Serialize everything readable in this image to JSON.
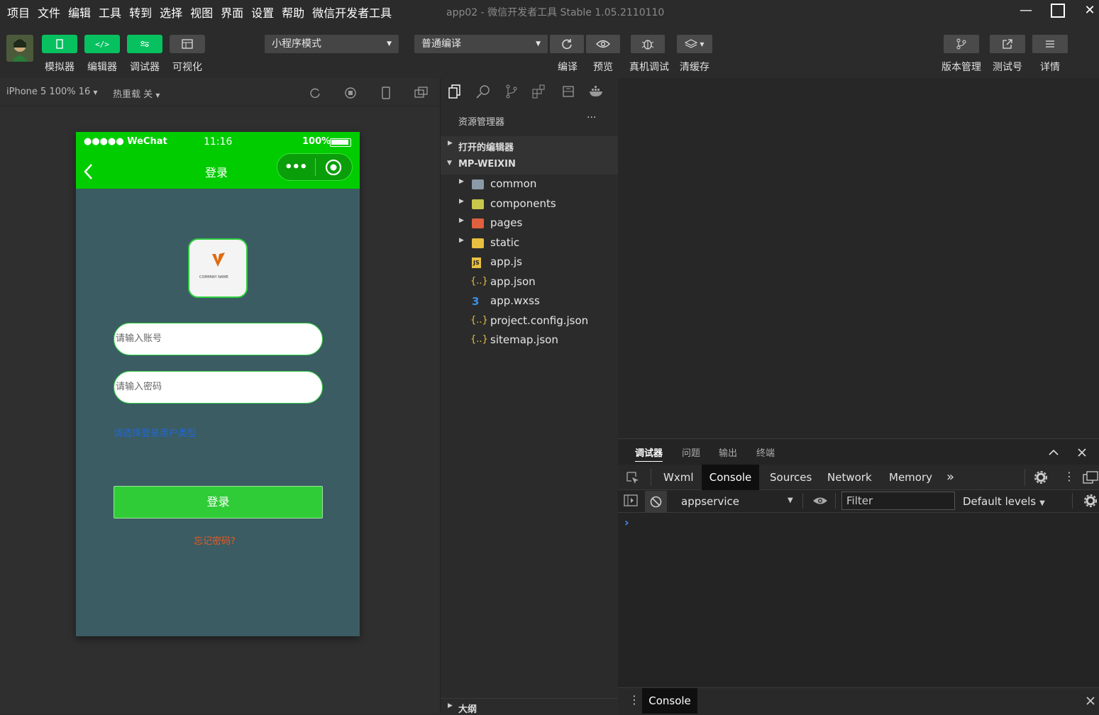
{
  "menubar": {
    "items": [
      "项目",
      "文件",
      "编辑",
      "工具",
      "转到",
      "选择",
      "视图",
      "界面",
      "设置",
      "帮助",
      "微信开发者工具"
    ],
    "window_title": "app02 - 微信开发者工具 Stable 1.05.2110110"
  },
  "toolbar": {
    "left_buttons": [
      {
        "label": "模拟器",
        "icon": "phone-icon"
      },
      {
        "label": "编辑器",
        "icon": "code-icon"
      },
      {
        "label": "调试器",
        "icon": "sliders-icon"
      },
      {
        "label": "可视化",
        "icon": "layout-icon"
      }
    ],
    "mode_select": "小程序模式",
    "compile_select": "普通编译",
    "compile_buttons": [
      {
        "label": "编译",
        "icon": "refresh-icon"
      },
      {
        "label": "预览",
        "icon": "eye-icon"
      },
      {
        "label": "真机调试",
        "icon": "bug-icon"
      },
      {
        "label": "清缓存",
        "icon": "layers-icon"
      }
    ],
    "right_buttons": [
      {
        "label": "版本管理",
        "icon": "branch-icon"
      },
      {
        "label": "测试号",
        "icon": "share-icon"
      },
      {
        "label": "详情",
        "icon": "menu-icon"
      }
    ]
  },
  "simbar": {
    "device": "iPhone 5 100% 16",
    "hot_reload": "热重载 关"
  },
  "phone": {
    "status_signal": "●●●●● WeChat",
    "status_time": "11:16",
    "status_battery": "100%",
    "nav_title": "登录",
    "logo_text": "COMPANY NAME",
    "account_placeholder": "请输入账号",
    "password_placeholder": "请输入密码",
    "user_type_link": "请选择登录用户类型",
    "login_button": "登录",
    "forgot_link": "忘记密码?"
  },
  "explorer": {
    "title": "资源管理器",
    "more": "···",
    "open_editors": "打开的编辑器",
    "project": "MP-WEIXIN",
    "items": [
      {
        "name": "common",
        "kind": "folder",
        "color": "#8a9aa8"
      },
      {
        "name": "components",
        "kind": "folder",
        "color": "#c8c84a"
      },
      {
        "name": "pages",
        "kind": "folder",
        "color": "#e06040"
      },
      {
        "name": "static",
        "kind": "folder",
        "color": "#e8c040"
      },
      {
        "name": "app.js",
        "kind": "js",
        "badge": "JS"
      },
      {
        "name": "app.json",
        "kind": "json",
        "badge": "{..}"
      },
      {
        "name": "app.wxss",
        "kind": "css",
        "badge": "3"
      },
      {
        "name": "project.config.json",
        "kind": "json",
        "badge": "{..}"
      },
      {
        "name": "sitemap.json",
        "kind": "json",
        "badge": "{..}"
      }
    ],
    "outline": "大纲"
  },
  "devtools": {
    "tabs": [
      "调试器",
      "问题",
      "输出",
      "终端"
    ],
    "subtabs": [
      "Wxml",
      "Console",
      "Sources",
      "Network",
      "Memory"
    ],
    "more_tabs": "»",
    "context": "appservice",
    "filter_placeholder": "Filter",
    "levels": "Default levels",
    "prompt": "›",
    "drawer_tab": "Console",
    "drawer_dots": "⋮"
  },
  "colors": {
    "wechat_green": "#07c160",
    "phone_header": "#00cc00",
    "phone_bg": "#3b5c63",
    "login_button": "#30cc38",
    "link_blue": "#1f68d6",
    "forgot_orange": "#e85a20"
  }
}
